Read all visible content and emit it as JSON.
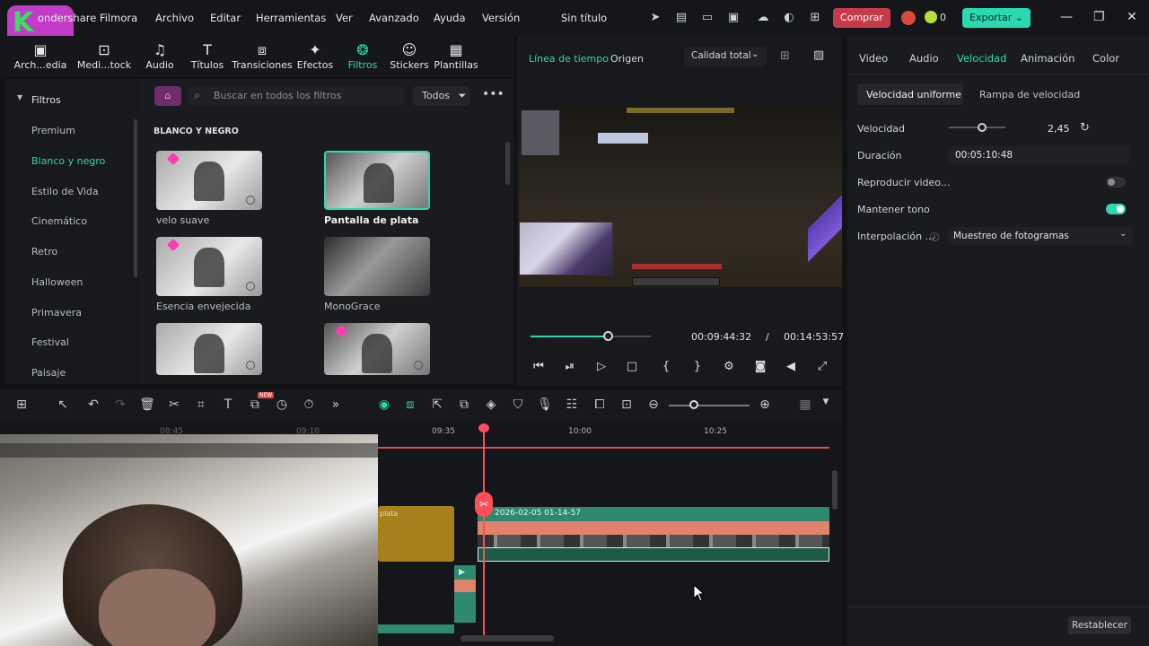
{
  "titlebar": {
    "app_name": "ondershare Filmora",
    "menus": [
      "Archivo",
      "Editar",
      "Herramientas",
      "Ver",
      "Avanzado",
      "Ayuda",
      "Versión"
    ],
    "project_title": "Sin título",
    "buy_label": "Comprar",
    "badge_count": "0",
    "export_label": "Exportar"
  },
  "toolbar": {
    "items": [
      "Arch...edia",
      "Medi...tock",
      "Audio",
      "Títulos",
      "Transiciones",
      "Efectos",
      "Filtros",
      "Stickers",
      "Plantillas"
    ],
    "active": "Filtros"
  },
  "filters_panel": {
    "sidebar_title": "Filtros",
    "categories": [
      "Premium",
      "Blanco y negro",
      "Estilo de Vida",
      "Cinemático",
      "Retro",
      "Halloween",
      "Primavera",
      "Festival",
      "Paisaje"
    ],
    "active_category": "Blanco y negro",
    "search_placeholder": "Buscar en todos los filtros",
    "filter_button": "Todos",
    "section_title": "BLANCO Y NEGRO",
    "items": [
      "velo suave",
      "Pantalla de plata",
      "Esencia envejecida",
      "MonoGrace"
    ]
  },
  "preview": {
    "tab_timeline": "Línea de tiempo",
    "tab_source": "Origen",
    "quality": "Calidad total",
    "current_time": "00:09:44:32",
    "separator": "/",
    "total_time": "00:14:53:57",
    "progress": 0.64
  },
  "properties": {
    "tabs": [
      "Video",
      "Audio",
      "Velocidad",
      "Animación",
      "Color"
    ],
    "active_tab": "Velocidad",
    "segment_uniform": "Velocidad uniforme",
    "segment_ramp": "Rampa de velocidad",
    "speed_label": "Velocidad",
    "speed_value": "2,45",
    "duration_label": "Duración",
    "duration_value": "00:05:10:48",
    "reverse_label": "Reproducir video...",
    "keep_pitch_label": "Mantener tono",
    "interp_label": "Interpolación ...",
    "interp_value": "Muestreo de fotogramas",
    "reset_label": "Restablecer",
    "reverse_on": false,
    "keep_pitch_on": true
  },
  "timeline": {
    "ruler_labels": [
      "09:35",
      "10:00",
      "10:25"
    ],
    "left_ruler_labels": [
      "08:45",
      "09:10"
    ],
    "clip_gold_label": "plata",
    "clip_main_label": "2026-02-05 01-14-57",
    "badge_new": "NEW"
  },
  "colors": {
    "accent": "#2bd9b0",
    "buy": "#c73a4a",
    "playhead": "#ff4d5a"
  }
}
